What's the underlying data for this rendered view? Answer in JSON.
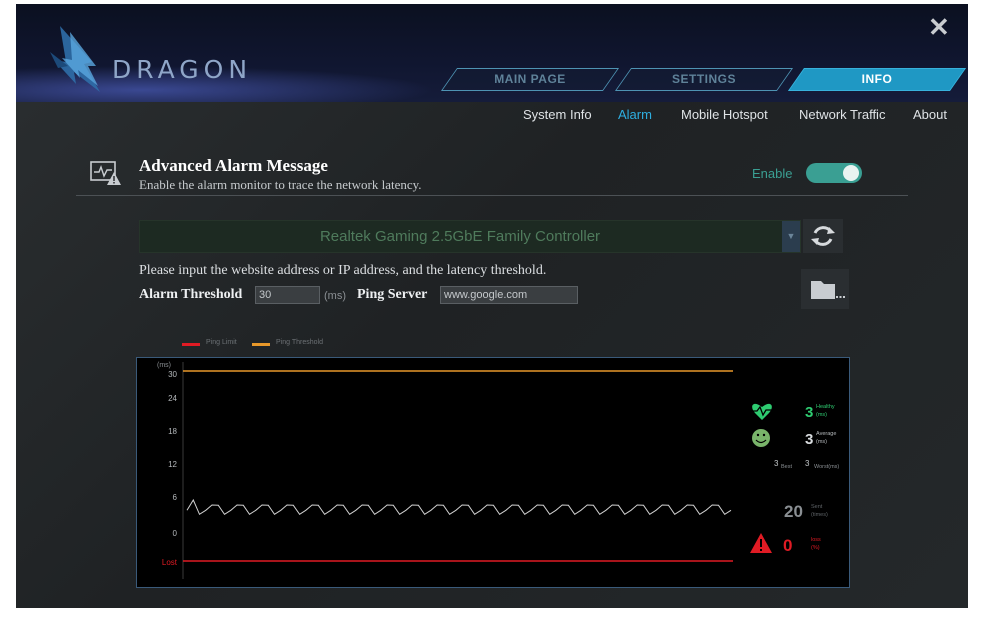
{
  "app": {
    "brand": "DRAGON",
    "close_symbol": "✕"
  },
  "tabs": [
    {
      "label": "MAIN PAGE",
      "active": false
    },
    {
      "label": "SETTINGS",
      "active": false
    },
    {
      "label": "INFO",
      "active": true
    }
  ],
  "subnav": [
    {
      "label": "System Info",
      "active": false
    },
    {
      "label": "Alarm",
      "active": true
    },
    {
      "label": "Mobile Hotspot",
      "active": false
    },
    {
      "label": "Network Traffic",
      "active": false
    },
    {
      "label": "About",
      "active": false
    }
  ],
  "section": {
    "icon": "alarm-monitor-icon",
    "title": "Advanced Alarm Message",
    "description": "Enable the alarm monitor to trace the network latency.",
    "enable_label": "Enable",
    "enabled": true
  },
  "adapter": {
    "selected": "Realtek Gaming 2.5GbE Family Controller",
    "refresh_icon": "refresh-icon"
  },
  "form": {
    "instruction": "Please input the website address or IP address, and the latency threshold.",
    "threshold_label": "Alarm Threshold",
    "threshold_value": "30",
    "threshold_unit": "(ms)",
    "ping_label": "Ping Server",
    "ping_value": "www.google.com",
    "folder_icon": "folder-icon"
  },
  "colors": {
    "accent": "#1f98c4",
    "toggle": "#3a9f93",
    "ping_limit": "#e01b24",
    "ping_threshold": "#e8982a",
    "healthy": "#2ecc71",
    "lost": "#e01b24",
    "trace": "#d0d0d0"
  },
  "chart_data": {
    "type": "line",
    "legend": [
      {
        "name": "Ping Limit",
        "color": "#e01b24"
      },
      {
        "name": "Ping Threshold",
        "color": "#e8982a"
      }
    ],
    "ylabel": "(ms)",
    "yticks": [
      "30",
      "24",
      "18",
      "12",
      "6",
      "0"
    ],
    "ylim": [
      0,
      30
    ],
    "lost_label": "Lost",
    "threshold": 30,
    "series": [
      {
        "name": "",
        "values": [
          2,
          3,
          2,
          2,
          3,
          2,
          2,
          2,
          3,
          2,
          2,
          2,
          3,
          2,
          2,
          2,
          3,
          2,
          2,
          2,
          3,
          2,
          2,
          2,
          3,
          2,
          2,
          2,
          3,
          2,
          2,
          2,
          3,
          2,
          2,
          2,
          3,
          2,
          2,
          2,
          3,
          2,
          2,
          2,
          3,
          2,
          2,
          2,
          3,
          2,
          2,
          2,
          3,
          2,
          2,
          2,
          3,
          2,
          2,
          2,
          3,
          2,
          2,
          2,
          3,
          2,
          2,
          2,
          3,
          2,
          2,
          2,
          3,
          2,
          2,
          2,
          3,
          2,
          2,
          2,
          3,
          2,
          2,
          2,
          3,
          2,
          2,
          2
        ]
      }
    ],
    "stats": {
      "healthy": {
        "value": "3",
        "label_line1": "Healthy",
        "label_line2": "(ms)",
        "icon": "heart-monitor-icon"
      },
      "average": {
        "value": "3",
        "label_line1": "Average",
        "label_line2": "(ms)",
        "icon": "smiley-icon"
      },
      "best": {
        "value": "3",
        "label": "Best"
      },
      "worst": {
        "value": "3",
        "label": "Worst(ms)"
      },
      "sent": {
        "value": "20",
        "label_line1": "Sent",
        "label_line2": "(times)"
      },
      "loss": {
        "value": "0",
        "label_line1": "loss",
        "label_line2": "(%)",
        "icon": "warning-icon"
      }
    }
  }
}
